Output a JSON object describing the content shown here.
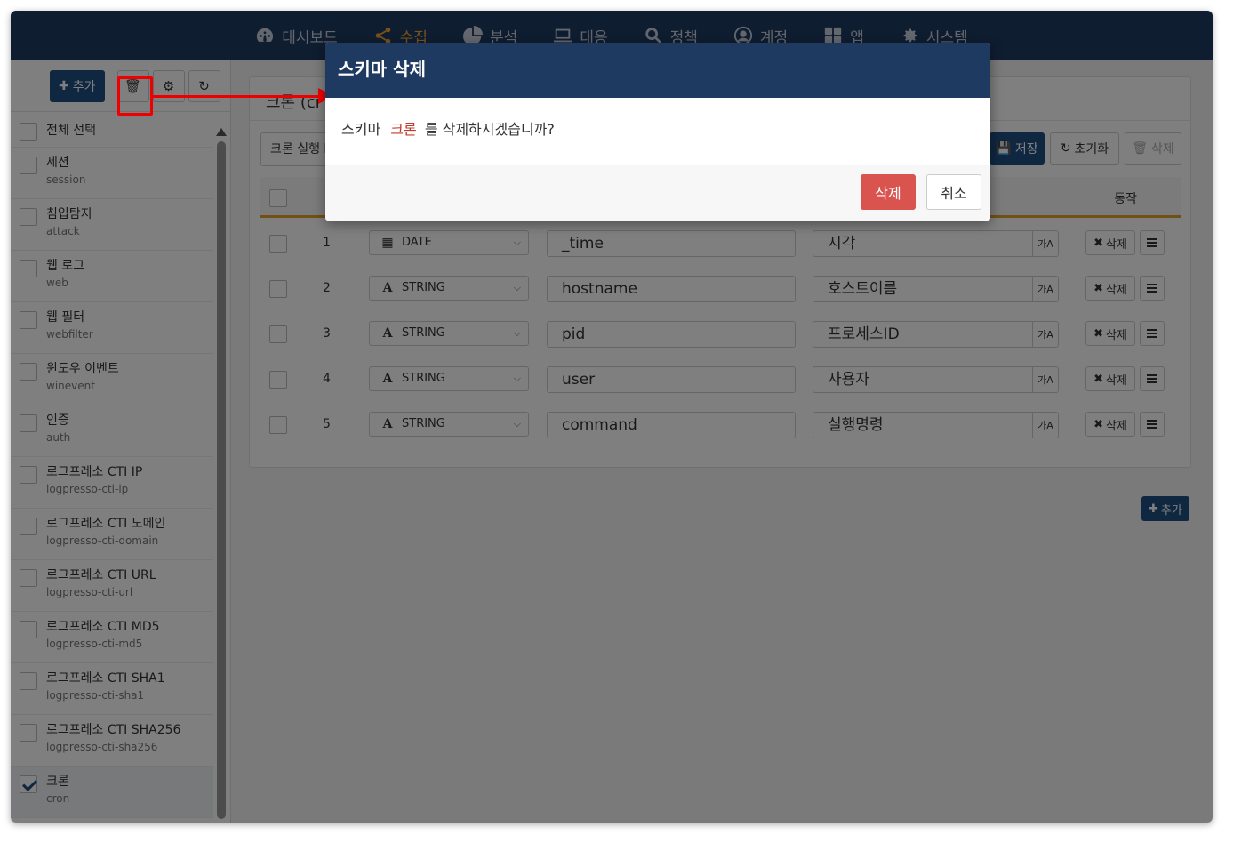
{
  "nav": {
    "items": [
      {
        "label": "대시보드",
        "icon": "dashboard-icon"
      },
      {
        "label": "수집",
        "icon": "share-icon",
        "active": true
      },
      {
        "label": "분석",
        "icon": "pie-chart-icon"
      },
      {
        "label": "대응",
        "icon": "laptop-icon"
      },
      {
        "label": "정책",
        "icon": "search-icon"
      },
      {
        "label": "계정",
        "icon": "user-circle-icon"
      },
      {
        "label": "앱",
        "icon": "grid-icon"
      },
      {
        "label": "시스템",
        "icon": "gear-icon"
      }
    ]
  },
  "sidebar": {
    "add_label": "추가",
    "select_all": "전체 선택",
    "items": [
      {
        "name": "세션",
        "sub": "session"
      },
      {
        "name": "침입탐지",
        "sub": "attack"
      },
      {
        "name": "웹 로그",
        "sub": "web"
      },
      {
        "name": "웹 필터",
        "sub": "webfilter"
      },
      {
        "name": "윈도우 이벤트",
        "sub": "winevent"
      },
      {
        "name": "인증",
        "sub": "auth"
      },
      {
        "name": "로그프레소 CTI IP",
        "sub": "logpresso-cti-ip"
      },
      {
        "name": "로그프레소 CTI 도메인",
        "sub": "logpresso-cti-domain"
      },
      {
        "name": "로그프레소 CTI URL",
        "sub": "logpresso-cti-url"
      },
      {
        "name": "로그프레소 CTI MD5",
        "sub": "logpresso-cti-md5"
      },
      {
        "name": "로그프레소 CTI SHA1",
        "sub": "logpresso-cti-sha1"
      },
      {
        "name": "로그프레소 CTI SHA256",
        "sub": "logpresso-cti-sha256"
      },
      {
        "name": "크론",
        "sub": "cron",
        "selected": true
      }
    ]
  },
  "main": {
    "title": "크론 (cr",
    "description": "크론 실행 l",
    "save_label": "저장",
    "reset_label": "초기화",
    "delete_label": "삭제",
    "action_header": "동작",
    "add_label": "추가",
    "rows": [
      {
        "num": "1",
        "type": "DATE",
        "type_icon": "calendar-icon",
        "field": "_time",
        "label": "시각"
      },
      {
        "num": "2",
        "type": "STRING",
        "type_icon": "text-icon",
        "field": "hostname",
        "label": "호스트이름"
      },
      {
        "num": "3",
        "type": "STRING",
        "type_icon": "text-icon",
        "field": "pid",
        "label": "프로세스ID"
      },
      {
        "num": "4",
        "type": "STRING",
        "type_icon": "text-icon",
        "field": "user",
        "label": "사용자"
      },
      {
        "num": "5",
        "type": "STRING",
        "type_icon": "text-icon",
        "field": "command",
        "label": "실행명령"
      }
    ],
    "row_delete_label": "삭제"
  },
  "modal": {
    "title": "스키마 삭제",
    "body_prefix": "스키마",
    "body_name": "크론",
    "body_suffix": "를 삭제하시겠습니까?",
    "confirm_label": "삭제",
    "cancel_label": "취소"
  },
  "colors": {
    "nav_bg": "#1f3a60",
    "active": "#f0a33a",
    "primary": "#1f4f82",
    "danger": "#d9534f",
    "annotation": "#e00000"
  }
}
